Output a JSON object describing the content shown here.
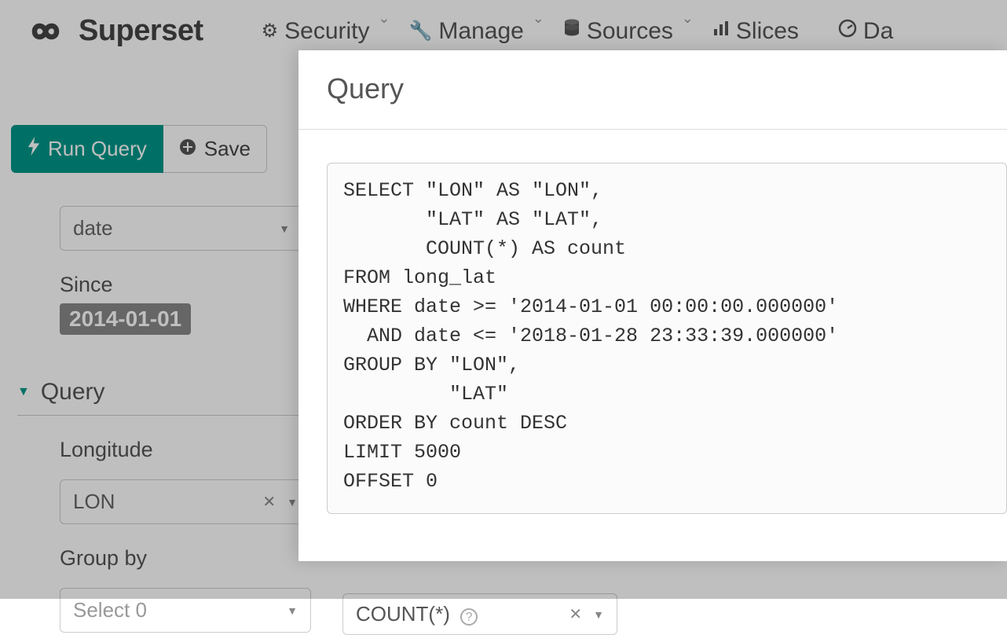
{
  "brand": "Superset",
  "nav": {
    "security": "Security",
    "manage": "Manage",
    "sources": "Sources",
    "slices": "Slices",
    "dashboards": "Da"
  },
  "toolbar": {
    "run_label": "Run Query",
    "save_label": "Save"
  },
  "form": {
    "date_field": "date",
    "since_label": "Since",
    "since_value": "2014-01-01",
    "query_section": "Query",
    "longitude_label": "Longitude",
    "longitude_value": "LON",
    "groupby_label": "Group by",
    "groupby_placeholder": "Select 0",
    "metric_value": "COUNT(*)"
  },
  "modal": {
    "title": "Query",
    "sql": "SELECT \"LON\" AS \"LON\",\n       \"LAT\" AS \"LAT\",\n       COUNT(*) AS count\nFROM long_lat\nWHERE date >= '2014-01-01 00:00:00.000000'\n  AND date <= '2018-01-28 23:33:39.000000'\nGROUP BY \"LON\",\n         \"LAT\"\nORDER BY count DESC\nLIMIT 5000\nOFFSET 0"
  }
}
